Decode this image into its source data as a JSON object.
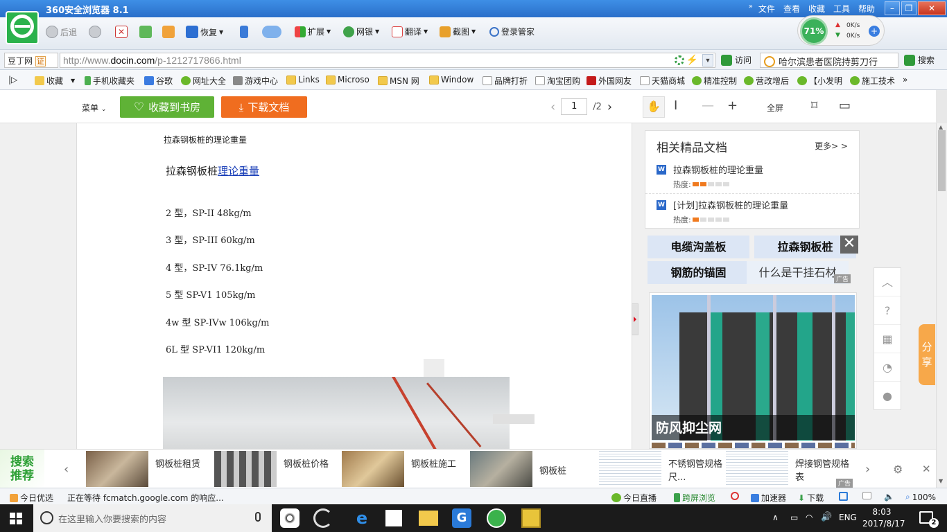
{
  "browser": {
    "title": "360安全浏览器 8.1",
    "menus": [
      "文件",
      "查看",
      "收藏",
      "工具",
      "帮助"
    ]
  },
  "toolbar": {
    "back": "后退",
    "restore": "恢复",
    "extend": "扩展",
    "bank": "网银",
    "translate": "翻译",
    "screenshot": "截图",
    "login": "登录管家",
    "speed_percent": "71%",
    "up_rate": "0K/s",
    "down_rate": "0K/s"
  },
  "address": {
    "site_tag": "豆丁网",
    "cert": "证",
    "url_prefix": "http://www.",
    "url_domain": "docin.com",
    "url_path": "/p-1212717866.html",
    "visit": "访问",
    "search_value": "哈尔滨患者医院持剪刀行",
    "search_btn": "搜索"
  },
  "bookmarks": [
    "收藏",
    "手机收藏夹",
    "谷歌",
    "网址大全",
    "游戏中心",
    "Links",
    "Microso",
    "MSN 网",
    "Window",
    "品牌打折",
    "淘宝团购",
    "外国网友",
    "天猫商城",
    "精准控制",
    "营改增后",
    "【小发明",
    "施工技术"
  ],
  "doc_toolbar": {
    "menu": "菜单",
    "fav": "收藏到书房",
    "download": "下载文档",
    "page_current": "1",
    "page_total": "/2",
    "fullscreen": "全屏"
  },
  "document": {
    "header": "拉森钢板桩的理论重量",
    "title_plain": "拉森钢板桩",
    "title_link": "理论重量",
    "specs": [
      "2 型，SP-II 48kg/m",
      "3 型，SP-III 60kg/m",
      "4 型，SP-IV 76.1kg/m",
      "5 型 SP-V1 105kg/m",
      "4w 型 SP-IVw 106kg/m",
      "6L 型 SP-VI1 120kg/m"
    ]
  },
  "related": {
    "heading": "相关精品文档",
    "more": "更多> >",
    "items": [
      {
        "title": "拉森钢板桩的理论重量",
        "heat_label": "热度:",
        "heat": 2
      },
      {
        "title": "[计划]拉森钢板桩的理论重量",
        "heat_label": "热度:",
        "heat": 1
      }
    ]
  },
  "ads": {
    "cells": [
      "电缆沟盖板",
      "拉森钢板桩",
      "钢筋的锚固",
      "什么是干挂石材"
    ],
    "tag": "广告",
    "image_caption": "防风抑尘网"
  },
  "share": "分享",
  "recommend": {
    "title_line1": "搜索",
    "title_line2": "推荐",
    "items": [
      "钢板桩租赁",
      "钢板桩价格",
      "钢板桩施工",
      "钢板桩",
      "不锈钢管规格尺...",
      "焊接钢管规格表"
    ],
    "tag": "广告"
  },
  "status": {
    "today_pick": "今日优选",
    "loading": "正在等待 fcmatch.google.com 的响应...",
    "live": "今日直播",
    "cross_screen": "跨屏浏览",
    "accelerator": "加速器",
    "download": "下载",
    "zoom": "100%"
  },
  "taskbar": {
    "search_placeholder": "在这里输入你要搜索的内容",
    "lang": "ENG",
    "time": "8:03",
    "date": "2017/8/17",
    "notifications": "2"
  }
}
